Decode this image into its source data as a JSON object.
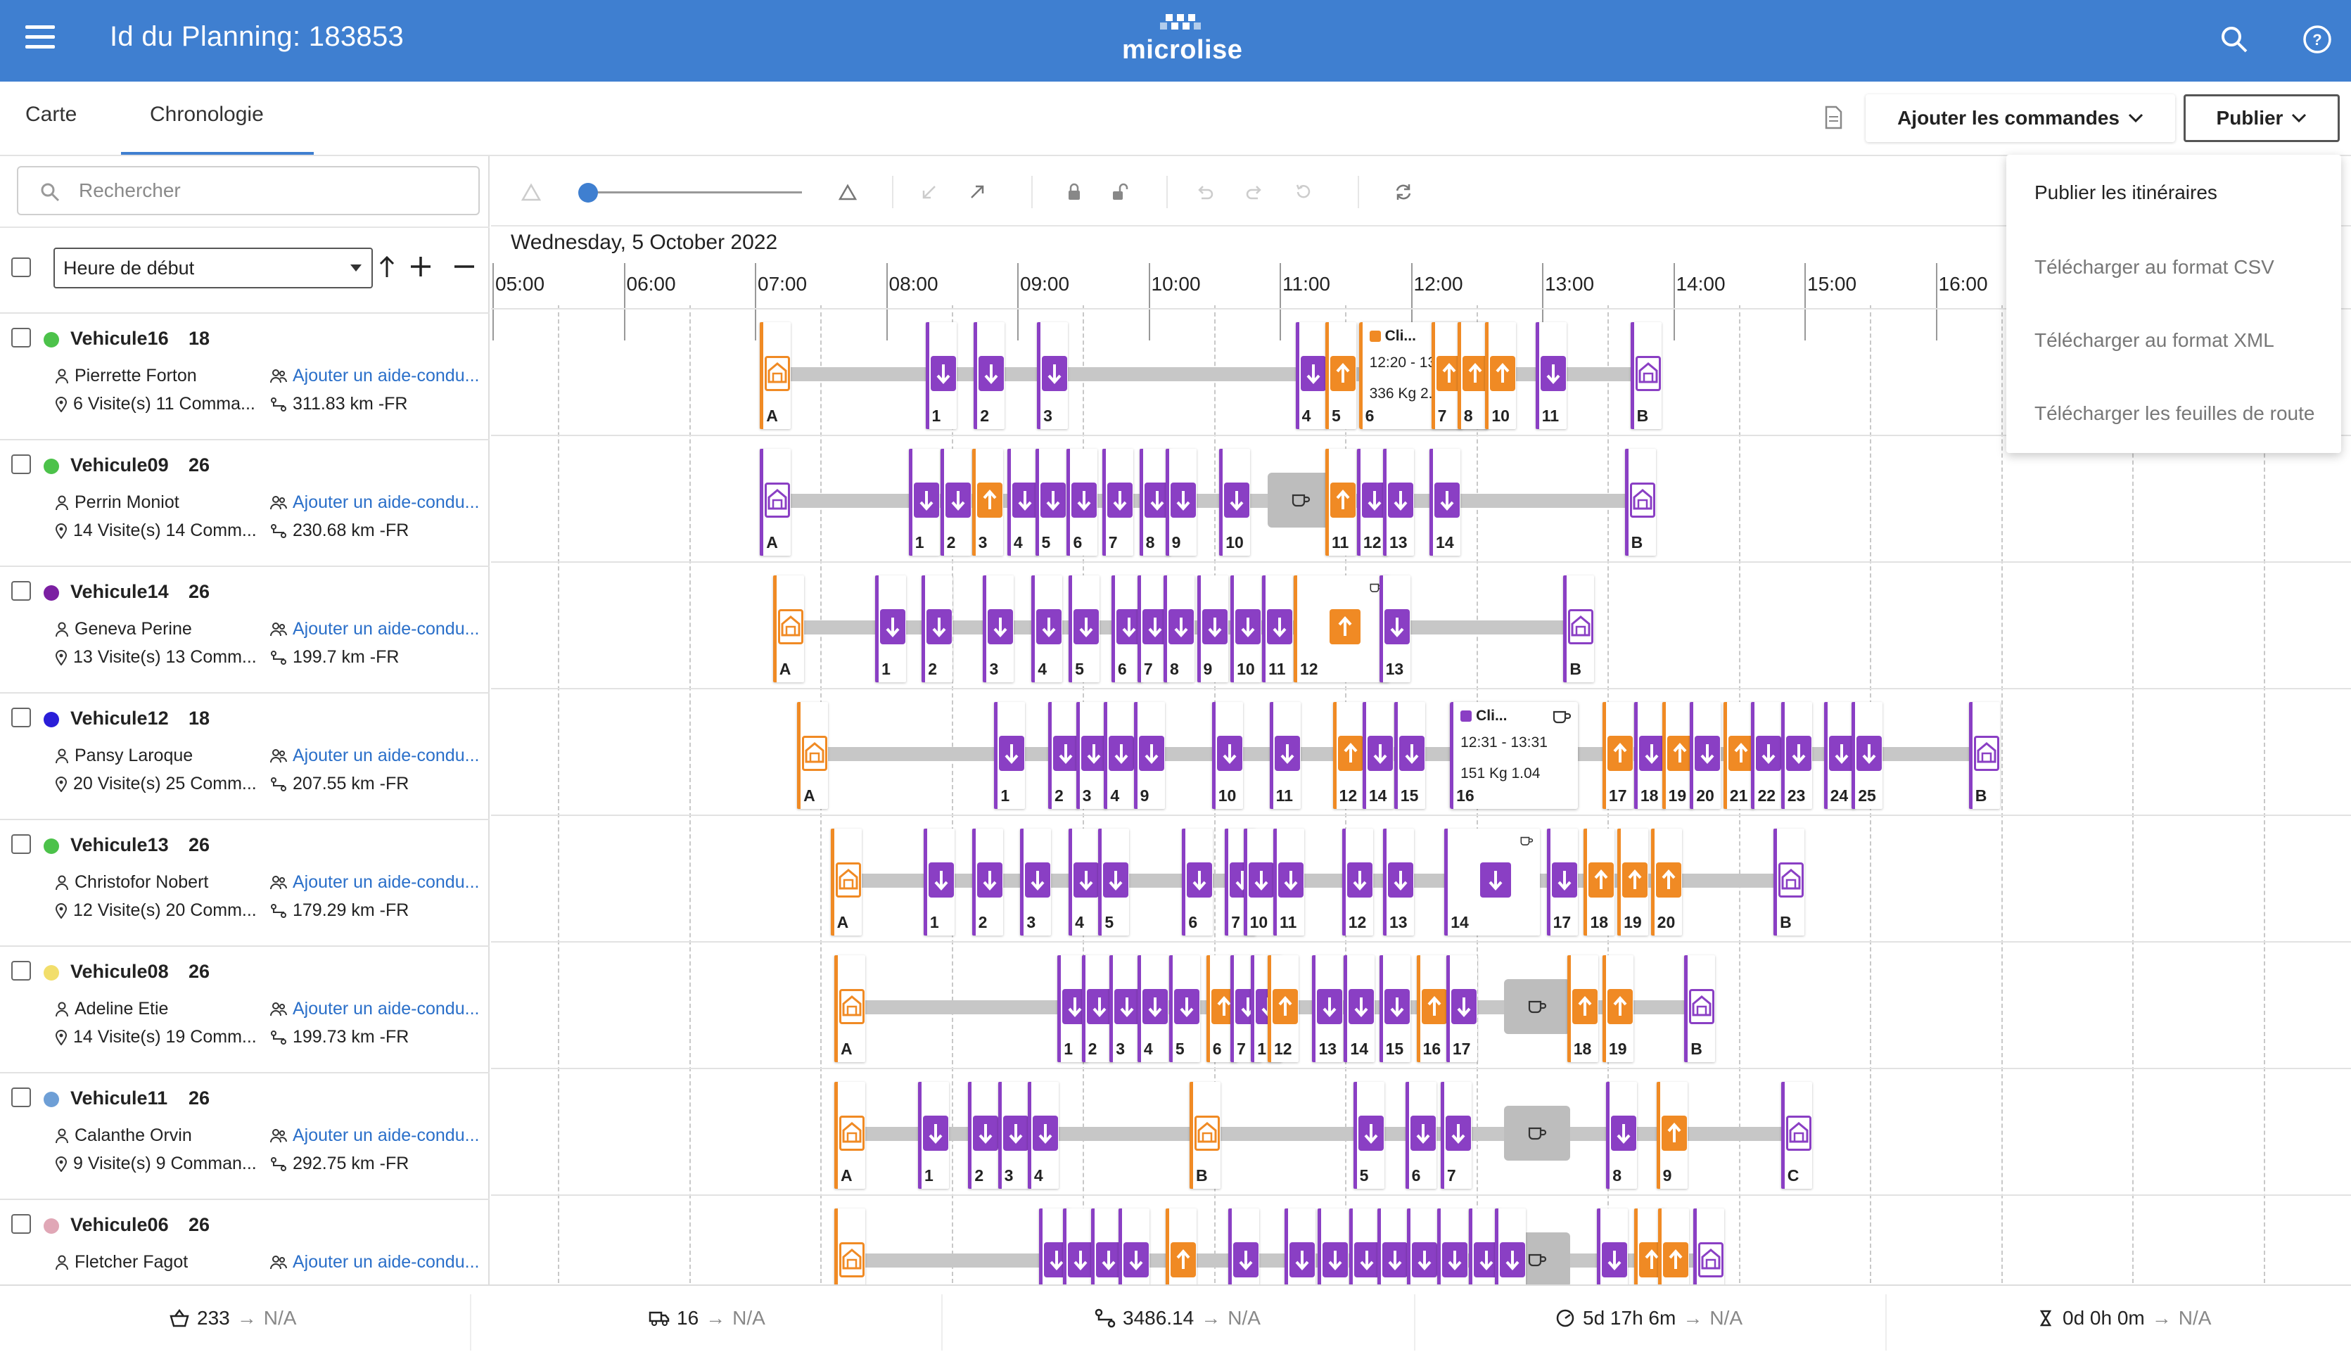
{
  "header": {
    "title": "Id du Planning: 183853",
    "logo_text": "microlise",
    "brand_color": "#3f7fd0"
  },
  "tabs": [
    {
      "label": "Carte",
      "active": false
    },
    {
      "label": "Chronologie",
      "active": true
    }
  ],
  "actions": {
    "add_orders_label": "Ajouter les commandes",
    "publish_label": "Publier"
  },
  "publish_menu": {
    "items": [
      "Publier les itinéraires",
      "Télécharger au format CSV",
      "Télécharger au format XML",
      "Télécharger les feuilles de route"
    ]
  },
  "search": {
    "placeholder": "Rechercher"
  },
  "sort": {
    "selected": "Heure de début"
  },
  "timeline": {
    "date": "Wednesday, 5 October 2022",
    "hours": [
      "05:00",
      "06:00",
      "07:00",
      "08:00",
      "09:00",
      "10:00",
      "11:00",
      "12:00",
      "13:00",
      "14:00",
      "15:00",
      "16:00"
    ]
  },
  "popups": [
    {
      "title": "Cli...",
      "time": "12:20 - 13:20",
      "load": "336 Kg 2.4 m"
    },
    {
      "title": "Cli...",
      "time": "12:31 - 13:31",
      "load": "151 Kg 1.04"
    }
  ],
  "vehicles": [
    {
      "name": "Vehicule16",
      "count": "18",
      "driver": "Pierrette Forton",
      "assist": "Ajouter un aide-condu...",
      "visits": "6 Visite(s) 11 Comma...",
      "distance": "311.83 km -FR",
      "color": "#4cc24a"
    },
    {
      "name": "Vehicule09",
      "count": "26",
      "driver": "Perrin Moniot",
      "assist": "Ajouter un aide-condu...",
      "visits": "14 Visite(s) 14 Comm...",
      "distance": "230.68 km -FR",
      "color": "#4cc24a"
    },
    {
      "name": "Vehicule14",
      "count": "26",
      "driver": "Geneva Perine",
      "assist": "Ajouter un aide-condu...",
      "visits": "13 Visite(s) 13 Comm...",
      "distance": "199.7 km -FR",
      "color": "#7b1fa2"
    },
    {
      "name": "Vehicule12",
      "count": "18",
      "driver": "Pansy Laroque",
      "assist": "Ajouter un aide-condu...",
      "visits": "20 Visite(s) 25 Comm...",
      "distance": "207.55 km -FR",
      "color": "#2a1ed8"
    },
    {
      "name": "Vehicule13",
      "count": "26",
      "driver": "Christofor Nobert",
      "assist": "Ajouter un aide-condu...",
      "visits": "12 Visite(s) 20 Comm...",
      "distance": "179.29 km -FR",
      "color": "#4cc24a"
    },
    {
      "name": "Vehicule08",
      "count": "26",
      "driver": "Adeline Etie",
      "assist": "Ajouter un aide-condu...",
      "visits": "14 Visite(s) 19 Comm...",
      "distance": "199.73 km -FR",
      "color": "#f2de6b"
    },
    {
      "name": "Vehicule11",
      "count": "26",
      "driver": "Calanthe Orvin",
      "assist": "Ajouter un aide-condu...",
      "visits": "9 Visite(s) 9 Comman...",
      "distance": "292.75 km -FR",
      "color": "#6e9fd6"
    },
    {
      "name": "Vehicule06",
      "count": "26",
      "driver": "Fletcher Fagot",
      "assist": "Ajouter un aide-condu...",
      "visits": "",
      "distance": "",
      "color": "#e0a7b6"
    }
  ],
  "lanes": [
    {
      "bar": [
        0.05,
        0.41
      ],
      "breaks": [],
      "stops": [
        [
          "A",
          "o",
          0.05,
          "d"
        ],
        [
          "1",
          "p",
          0.139,
          "x"
        ],
        [
          "2",
          "p",
          0.165,
          "x"
        ],
        [
          "3",
          "p",
          0.199,
          "x"
        ],
        [
          "4",
          "p",
          0.338,
          "x"
        ],
        [
          "5",
          "o",
          0.354,
          "u"
        ],
        [
          "6",
          "o",
          0.372,
          "pop0"
        ],
        [
          "7",
          "o",
          0.411,
          "u"
        ],
        [
          "8",
          "o",
          0.425,
          "u"
        ],
        [
          "10",
          "o",
          0.44,
          "u"
        ],
        [
          "11",
          "p",
          0.467,
          "x"
        ],
        [
          "B",
          "p",
          0.518,
          "d"
        ]
      ]
    },
    {
      "bar": [
        0.05,
        0.52
      ],
      "breaks": [
        0.323
      ],
      "stops": [
        [
          "A",
          "p",
          0.05,
          "d"
        ],
        [
          "1",
          "p",
          0.13,
          "x"
        ],
        [
          "2",
          "p",
          0.147,
          "x"
        ],
        [
          "3",
          "o",
          0.164,
          "u"
        ],
        [
          "4",
          "p",
          0.183,
          "x"
        ],
        [
          "5",
          "p",
          0.198,
          "x"
        ],
        [
          "6",
          "p",
          0.215,
          "x"
        ],
        [
          "7",
          "p",
          0.234,
          "x"
        ],
        [
          "8",
          "p",
          0.254,
          "x"
        ],
        [
          "9",
          "p",
          0.268,
          "x"
        ],
        [
          "10",
          "p",
          0.297,
          "x"
        ],
        [
          "11",
          "o",
          0.354,
          "u"
        ],
        [
          "12",
          "p",
          0.371,
          "x"
        ],
        [
          "13",
          "p",
          0.385,
          "x"
        ],
        [
          "14",
          "p",
          0.41,
          "x"
        ],
        [
          "B",
          "p",
          0.515,
          "d"
        ]
      ]
    },
    {
      "bar": [
        0.057,
        0.52
      ],
      "breaks": [],
      "stops": [
        [
          "A",
          "o",
          0.057,
          "d"
        ],
        [
          "1",
          "p",
          0.112,
          "x"
        ],
        [
          "2",
          "p",
          0.137,
          "x"
        ],
        [
          "3",
          "p",
          0.17,
          "x"
        ],
        [
          "4",
          "p",
          0.196,
          "x"
        ],
        [
          "5",
          "p",
          0.216,
          "x"
        ],
        [
          "6",
          "p",
          0.239,
          "x"
        ],
        [
          "7",
          "p",
          0.253,
          "x"
        ],
        [
          "8",
          "p",
          0.267,
          "x"
        ],
        [
          "9",
          "p",
          0.285,
          "x"
        ],
        [
          "10",
          "p",
          0.303,
          "x"
        ],
        [
          "11",
          "p",
          0.32,
          "x"
        ],
        [
          "12",
          "o",
          0.337,
          "big"
        ],
        [
          "13",
          "p",
          0.383,
          "x"
        ],
        [
          "B",
          "p",
          0.482,
          "d"
        ]
      ]
    },
    {
      "bar": [
        0.07,
        0.76
      ],
      "breaks": [],
      "stops": [
        [
          "A",
          "o",
          0.07,
          "d"
        ],
        [
          "1",
          "p",
          0.176,
          "x"
        ],
        [
          "2",
          "p",
          0.205,
          "x"
        ],
        [
          "3",
          "p",
          0.22,
          "x"
        ],
        [
          "4",
          "p",
          0.235,
          "x"
        ],
        [
          "9",
          "p",
          0.251,
          "x"
        ],
        [
          "10",
          "p",
          0.293,
          "x"
        ],
        [
          "11",
          "p",
          0.324,
          "x"
        ],
        [
          "12",
          "o",
          0.358,
          "u"
        ],
        [
          "14",
          "p",
          0.374,
          "x"
        ],
        [
          "15",
          "p",
          0.391,
          "x"
        ],
        [
          "16",
          "p",
          0.421,
          "pop1"
        ],
        [
          "17",
          "o",
          0.503,
          "u"
        ],
        [
          "18",
          "p",
          0.52,
          "x"
        ],
        [
          "19",
          "o",
          0.535,
          "u"
        ],
        [
          "20",
          "p",
          0.55,
          "x"
        ],
        [
          "21",
          "o",
          0.568,
          "u"
        ],
        [
          "22",
          "p",
          0.583,
          "x"
        ],
        [
          "23",
          "p",
          0.599,
          "x"
        ],
        [
          "24",
          "p",
          0.622,
          "x"
        ],
        [
          "25",
          "p",
          0.637,
          "x"
        ],
        [
          "B",
          "p",
          0.7,
          "d"
        ]
      ]
    },
    {
      "bar": [
        0.088,
        0.64
      ],
      "breaks": [],
      "stops": [
        [
          "A",
          "o",
          0.088,
          "d"
        ],
        [
          "1",
          "p",
          0.138,
          "x"
        ],
        [
          "2",
          "p",
          0.164,
          "x"
        ],
        [
          "3",
          "p",
          0.19,
          "x"
        ],
        [
          "4",
          "p",
          0.216,
          "x"
        ],
        [
          "5",
          "p",
          0.232,
          "x"
        ],
        [
          "6",
          "p",
          0.277,
          "x"
        ],
        [
          "7",
          "p",
          0.3,
          "x"
        ],
        [
          "10",
          "p",
          0.31,
          "x"
        ],
        [
          "11",
          "p",
          0.326,
          "x"
        ],
        [
          "12",
          "p",
          0.363,
          "x"
        ],
        [
          "13",
          "p",
          0.385,
          "x"
        ],
        [
          "14",
          "p",
          0.418,
          "big"
        ],
        [
          "17",
          "p",
          0.473,
          "x"
        ],
        [
          "18",
          "o",
          0.493,
          "u"
        ],
        [
          "19",
          "o",
          0.511,
          "u"
        ],
        [
          "20",
          "o",
          0.529,
          "u"
        ],
        [
          "B",
          "p",
          0.595,
          "d"
        ]
      ]
    },
    {
      "bar": [
        0.09,
        0.58
      ],
      "breaks": [
        0.45
      ],
      "stops": [
        [
          "A",
          "o",
          0.09,
          "d"
        ],
        [
          "1",
          "p",
          0.21,
          "x"
        ],
        [
          "2",
          "p",
          0.223,
          "x"
        ],
        [
          "3",
          "p",
          0.238,
          "x"
        ],
        [
          "4",
          "p",
          0.253,
          "x"
        ],
        [
          "5",
          "p",
          0.27,
          "x"
        ],
        [
          "6",
          "o",
          0.29,
          "u"
        ],
        [
          "7",
          "p",
          0.303,
          "x"
        ],
        [
          "1",
          "p",
          0.314,
          "x"
        ],
        [
          "12",
          "o",
          0.323,
          "u"
        ],
        [
          "13",
          "p",
          0.347,
          "x"
        ],
        [
          "14",
          "p",
          0.364,
          "x"
        ],
        [
          "15",
          "p",
          0.383,
          "x"
        ],
        [
          "16",
          "o",
          0.403,
          "u"
        ],
        [
          "17",
          "p",
          0.419,
          "x"
        ],
        [
          "18",
          "o",
          0.484,
          "u"
        ],
        [
          "19",
          "o",
          0.503,
          "u"
        ],
        [
          "B",
          "p",
          0.547,
          "d"
        ]
      ]
    },
    {
      "bar": [
        0.09,
        0.58
      ],
      "breaks": [
        0.45
      ],
      "stops": [
        [
          "A",
          "o",
          0.09,
          "d"
        ],
        [
          "1",
          "p",
          0.135,
          "x"
        ],
        [
          "2",
          "p",
          0.162,
          "x"
        ],
        [
          "3",
          "p",
          0.178,
          "x"
        ],
        [
          "4",
          "p",
          0.194,
          "x"
        ],
        [
          "B",
          "o",
          0.281,
          "d"
        ],
        [
          "5",
          "p",
          0.369,
          "x"
        ],
        [
          "6",
          "p",
          0.397,
          "x"
        ],
        [
          "7",
          "p",
          0.416,
          "x"
        ],
        [
          "8",
          "p",
          0.505,
          "x"
        ],
        [
          "9",
          "o",
          0.532,
          "u"
        ],
        [
          "C",
          "p",
          0.599,
          "d"
        ]
      ]
    },
    {
      "bar": [
        0.09,
        0.58
      ],
      "breaks": [
        0.45
      ],
      "stops": [
        [
          "",
          "o",
          0.09,
          "d"
        ],
        [
          "",
          "p",
          0.2,
          "x"
        ],
        [
          "",
          "p",
          0.213,
          "x"
        ],
        [
          "",
          "p",
          0.228,
          "x"
        ],
        [
          "",
          "p",
          0.243,
          "x"
        ],
        [
          "",
          "o",
          0.268,
          "u"
        ],
        [
          "",
          "p",
          0.302,
          "x"
        ],
        [
          "",
          "p",
          0.332,
          "x"
        ],
        [
          "",
          "p",
          0.35,
          "x"
        ],
        [
          "",
          "p",
          0.367,
          "x"
        ],
        [
          "",
          "p",
          0.382,
          "x"
        ],
        [
          "",
          "p",
          0.398,
          "x"
        ],
        [
          "",
          "p",
          0.414,
          "x"
        ],
        [
          "",
          "p",
          0.431,
          "x"
        ],
        [
          "",
          "p",
          0.445,
          "x"
        ],
        [
          "",
          "p",
          0.5,
          "x"
        ],
        [
          "",
          "o",
          0.52,
          "u"
        ],
        [
          "",
          "o",
          0.533,
          "u"
        ],
        [
          "",
          "p",
          0.552,
          "d"
        ]
      ]
    }
  ],
  "footer": {
    "orders": "233",
    "vehicles": "16",
    "distance": "3486.14",
    "duration": "5d 17h 6m",
    "idle": "0d 0h 0m",
    "target": "N/A"
  },
  "colors": {
    "delivery": "#8a3fc4",
    "pickup": "#f08a24",
    "route": "#c7c7c7"
  }
}
